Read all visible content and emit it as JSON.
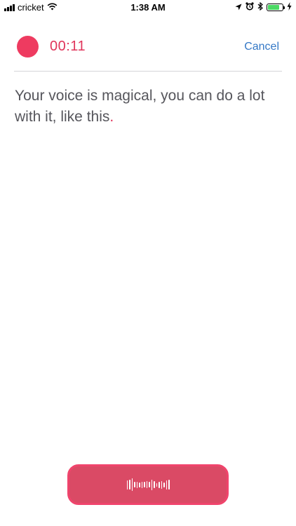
{
  "status_bar": {
    "carrier": "cricket",
    "time": "1:38 AM",
    "battery_level": 0.8,
    "icons": [
      "signal-icon",
      "wifi-icon",
      "location-icon",
      "alarm-icon",
      "bluetooth-icon",
      "battery-icon",
      "charging-icon"
    ]
  },
  "recorder": {
    "timer": "00:11",
    "cancel_label": "Cancel",
    "accent_color": "#ee3b60",
    "link_color": "#3478c6"
  },
  "transcript": {
    "text": "Your voice is magical, you can do a lot with it, like this",
    "end_mark": "."
  },
  "record_button": {
    "icon": "waveform-icon",
    "bars": [
      0.7,
      0.8,
      1.0,
      0.45,
      0.5,
      0.4,
      0.5,
      0.45,
      0.55,
      0.45,
      0.85,
      0.55,
      0.3,
      0.5,
      0.6,
      0.4,
      0.7,
      0.8
    ]
  }
}
